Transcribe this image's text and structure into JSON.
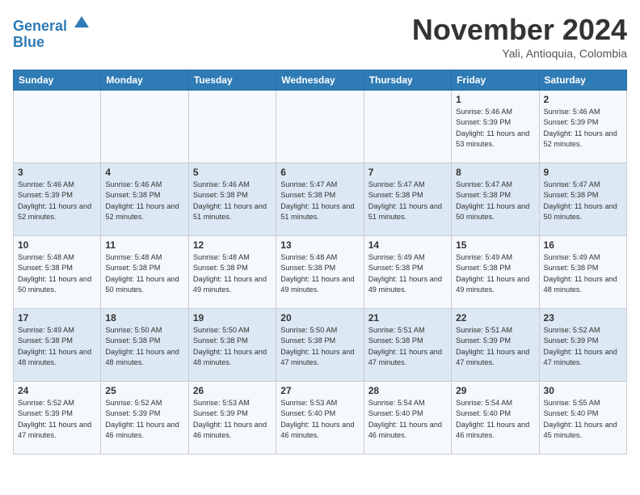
{
  "logo": {
    "line1": "General",
    "line2": "Blue"
  },
  "title": "November 2024",
  "location": "Yali, Antioquia, Colombia",
  "days_of_week": [
    "Sunday",
    "Monday",
    "Tuesday",
    "Wednesday",
    "Thursday",
    "Friday",
    "Saturday"
  ],
  "weeks": [
    [
      {
        "day": "",
        "info": ""
      },
      {
        "day": "",
        "info": ""
      },
      {
        "day": "",
        "info": ""
      },
      {
        "day": "",
        "info": ""
      },
      {
        "day": "",
        "info": ""
      },
      {
        "day": "1",
        "info": "Sunrise: 5:46 AM\nSunset: 5:39 PM\nDaylight: 11 hours\nand 53 minutes."
      },
      {
        "day": "2",
        "info": "Sunrise: 5:46 AM\nSunset: 5:39 PM\nDaylight: 11 hours\nand 52 minutes."
      }
    ],
    [
      {
        "day": "3",
        "info": "Sunrise: 5:46 AM\nSunset: 5:39 PM\nDaylight: 11 hours\nand 52 minutes."
      },
      {
        "day": "4",
        "info": "Sunrise: 5:46 AM\nSunset: 5:38 PM\nDaylight: 11 hours\nand 52 minutes."
      },
      {
        "day": "5",
        "info": "Sunrise: 5:46 AM\nSunset: 5:38 PM\nDaylight: 11 hours\nand 51 minutes."
      },
      {
        "day": "6",
        "info": "Sunrise: 5:47 AM\nSunset: 5:38 PM\nDaylight: 11 hours\nand 51 minutes."
      },
      {
        "day": "7",
        "info": "Sunrise: 5:47 AM\nSunset: 5:38 PM\nDaylight: 11 hours\nand 51 minutes."
      },
      {
        "day": "8",
        "info": "Sunrise: 5:47 AM\nSunset: 5:38 PM\nDaylight: 11 hours\nand 50 minutes."
      },
      {
        "day": "9",
        "info": "Sunrise: 5:47 AM\nSunset: 5:38 PM\nDaylight: 11 hours\nand 50 minutes."
      }
    ],
    [
      {
        "day": "10",
        "info": "Sunrise: 5:48 AM\nSunset: 5:38 PM\nDaylight: 11 hours\nand 50 minutes."
      },
      {
        "day": "11",
        "info": "Sunrise: 5:48 AM\nSunset: 5:38 PM\nDaylight: 11 hours\nand 50 minutes."
      },
      {
        "day": "12",
        "info": "Sunrise: 5:48 AM\nSunset: 5:38 PM\nDaylight: 11 hours\nand 49 minutes."
      },
      {
        "day": "13",
        "info": "Sunrise: 5:48 AM\nSunset: 5:38 PM\nDaylight: 11 hours\nand 49 minutes."
      },
      {
        "day": "14",
        "info": "Sunrise: 5:49 AM\nSunset: 5:38 PM\nDaylight: 11 hours\nand 49 minutes."
      },
      {
        "day": "15",
        "info": "Sunrise: 5:49 AM\nSunset: 5:38 PM\nDaylight: 11 hours\nand 49 minutes."
      },
      {
        "day": "16",
        "info": "Sunrise: 5:49 AM\nSunset: 5:38 PM\nDaylight: 11 hours\nand 48 minutes."
      }
    ],
    [
      {
        "day": "17",
        "info": "Sunrise: 5:49 AM\nSunset: 5:38 PM\nDaylight: 11 hours\nand 48 minutes."
      },
      {
        "day": "18",
        "info": "Sunrise: 5:50 AM\nSunset: 5:38 PM\nDaylight: 11 hours\nand 48 minutes."
      },
      {
        "day": "19",
        "info": "Sunrise: 5:50 AM\nSunset: 5:38 PM\nDaylight: 11 hours\nand 48 minutes."
      },
      {
        "day": "20",
        "info": "Sunrise: 5:50 AM\nSunset: 5:38 PM\nDaylight: 11 hours\nand 47 minutes."
      },
      {
        "day": "21",
        "info": "Sunrise: 5:51 AM\nSunset: 5:38 PM\nDaylight: 11 hours\nand 47 minutes."
      },
      {
        "day": "22",
        "info": "Sunrise: 5:51 AM\nSunset: 5:39 PM\nDaylight: 11 hours\nand 47 minutes."
      },
      {
        "day": "23",
        "info": "Sunrise: 5:52 AM\nSunset: 5:39 PM\nDaylight: 11 hours\nand 47 minutes."
      }
    ],
    [
      {
        "day": "24",
        "info": "Sunrise: 5:52 AM\nSunset: 5:39 PM\nDaylight: 11 hours\nand 47 minutes."
      },
      {
        "day": "25",
        "info": "Sunrise: 5:52 AM\nSunset: 5:39 PM\nDaylight: 11 hours\nand 46 minutes."
      },
      {
        "day": "26",
        "info": "Sunrise: 5:53 AM\nSunset: 5:39 PM\nDaylight: 11 hours\nand 46 minutes."
      },
      {
        "day": "27",
        "info": "Sunrise: 5:53 AM\nSunset: 5:40 PM\nDaylight: 11 hours\nand 46 minutes."
      },
      {
        "day": "28",
        "info": "Sunrise: 5:54 AM\nSunset: 5:40 PM\nDaylight: 11 hours\nand 46 minutes."
      },
      {
        "day": "29",
        "info": "Sunrise: 5:54 AM\nSunset: 5:40 PM\nDaylight: 11 hours\nand 46 minutes."
      },
      {
        "day": "30",
        "info": "Sunrise: 5:55 AM\nSunset: 5:40 PM\nDaylight: 11 hours\nand 45 minutes."
      }
    ]
  ]
}
